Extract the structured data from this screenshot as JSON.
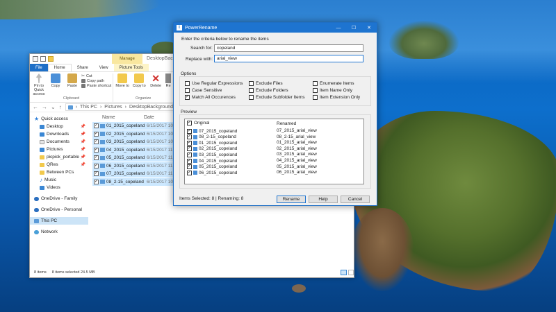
{
  "explorer": {
    "title": "DesktopBackground",
    "manage_tab": "Manage",
    "tabs": [
      "File",
      "Home",
      "Share",
      "View",
      "Picture Tools"
    ],
    "ribbon": {
      "pin_label": "Pin to Quick access",
      "copy_label": "Copy",
      "paste_label": "Paste",
      "cut_label": "Cut",
      "copy_path_label": "Copy path",
      "paste_shortcut_label": "Paste shortcut",
      "clipboard_group": "Clipboard",
      "move_label": "Move to",
      "copy_to_label": "Copy to",
      "delete_label": "Delete",
      "rename_label": "Re",
      "organize_group": "Organize"
    },
    "breadcrumb": [
      "This PC",
      "Pictures",
      "DesktopBackground"
    ],
    "nav": [
      {
        "label": "Quick access",
        "icon": "star-icon",
        "sub": false
      },
      {
        "label": "Desktop",
        "icon": "desktop-icon",
        "sub": true,
        "pinned": true
      },
      {
        "label": "Downloads",
        "icon": "downloads-icon",
        "sub": true,
        "pinned": true
      },
      {
        "label": "Documents",
        "icon": "documents-icon",
        "sub": true,
        "pinned": true
      },
      {
        "label": "Pictures",
        "icon": "pictures-icon",
        "sub": true,
        "pinned": true
      },
      {
        "label": "picpick_portable",
        "icon": "folder-icon",
        "sub": true,
        "pinned": true
      },
      {
        "label": "QRes",
        "icon": "folder-icon",
        "sub": true,
        "pinned": true
      },
      {
        "label": "Between PCs",
        "icon": "folder-icon",
        "sub": true
      },
      {
        "label": "Music",
        "icon": "music-icon",
        "sub": true
      },
      {
        "label": "Videos",
        "icon": "videos-icon",
        "sub": true
      },
      {
        "label": "OneDrive - Family",
        "icon": "cloud-icon",
        "sub": false
      },
      {
        "label": "OneDrive - Personal",
        "icon": "cloud-icon",
        "sub": false
      },
      {
        "label": "This PC",
        "icon": "pc-icon",
        "sub": false,
        "selected": true
      },
      {
        "label": "Network",
        "icon": "network-icon",
        "sub": false
      }
    ],
    "columns": {
      "name": "Name",
      "date": "Date"
    },
    "files": [
      {
        "name": "01_2015_copeland",
        "date": "6/15/2017 10"
      },
      {
        "name": "02_2015_copeland",
        "date": "6/15/2017 10"
      },
      {
        "name": "03_2015_copeland",
        "date": "6/15/2017 10"
      },
      {
        "name": "04_2015_copeland",
        "date": "6/15/2017 11"
      },
      {
        "name": "05_2015_copeland",
        "date": "6/15/2017 11"
      },
      {
        "name": "06_2015_copeland",
        "date": "6/15/2017 11"
      },
      {
        "name": "07_2015_copeland",
        "date": "6/15/2017 11"
      },
      {
        "name": "08_2-15_copeland",
        "date": "6/15/2017 10"
      }
    ],
    "status": {
      "items": "8 items",
      "selected": "8 items selected  24.5 MB"
    }
  },
  "powerrename": {
    "title": "PowerRename",
    "instruction": "Enter the criteria below to rename the items",
    "search_label": "Search for:",
    "search_value": "copeland",
    "replace_label": "Replace with:",
    "replace_value": "arial_view",
    "options_title": "Options",
    "options": {
      "regex": "Use Regular Expressions",
      "case": "Case Sensitive",
      "match_all": "Match All Occurences",
      "excl_files": "Exclude Files",
      "excl_folders": "Exclude Folders",
      "excl_sub": "Exclude Subfolder Items",
      "enumerate": "Enumerate Items",
      "name_only": "Item Name Only",
      "ext_only": "Item Extension Only"
    },
    "preview_title": "Preview",
    "col_original": "Original",
    "col_renamed": "Renamed",
    "rows": [
      {
        "original": "07_2015_copeland",
        "renamed": "07_2015_arial_view"
      },
      {
        "original": "08_2-15_copeland",
        "renamed": "08_2-15_arial_view"
      },
      {
        "original": "01_2015_copeland",
        "renamed": "01_2015_arial_view"
      },
      {
        "original": "02_2015_copeland",
        "renamed": "02_2015_arial_view"
      },
      {
        "original": "03_2015_copeland",
        "renamed": "03_2015_arial_view"
      },
      {
        "original": "04_2015_copeland",
        "renamed": "04_2015_arial_view"
      },
      {
        "original": "05_2015_copeland",
        "renamed": "05_2015_arial_view"
      },
      {
        "original": "06_2015_copeland",
        "renamed": "06_2015_arial_view"
      }
    ],
    "status": "Items Selected: 8 | Renaming: 8",
    "buttons": {
      "rename": "Rename",
      "help": "Help",
      "cancel": "Cancel"
    }
  }
}
